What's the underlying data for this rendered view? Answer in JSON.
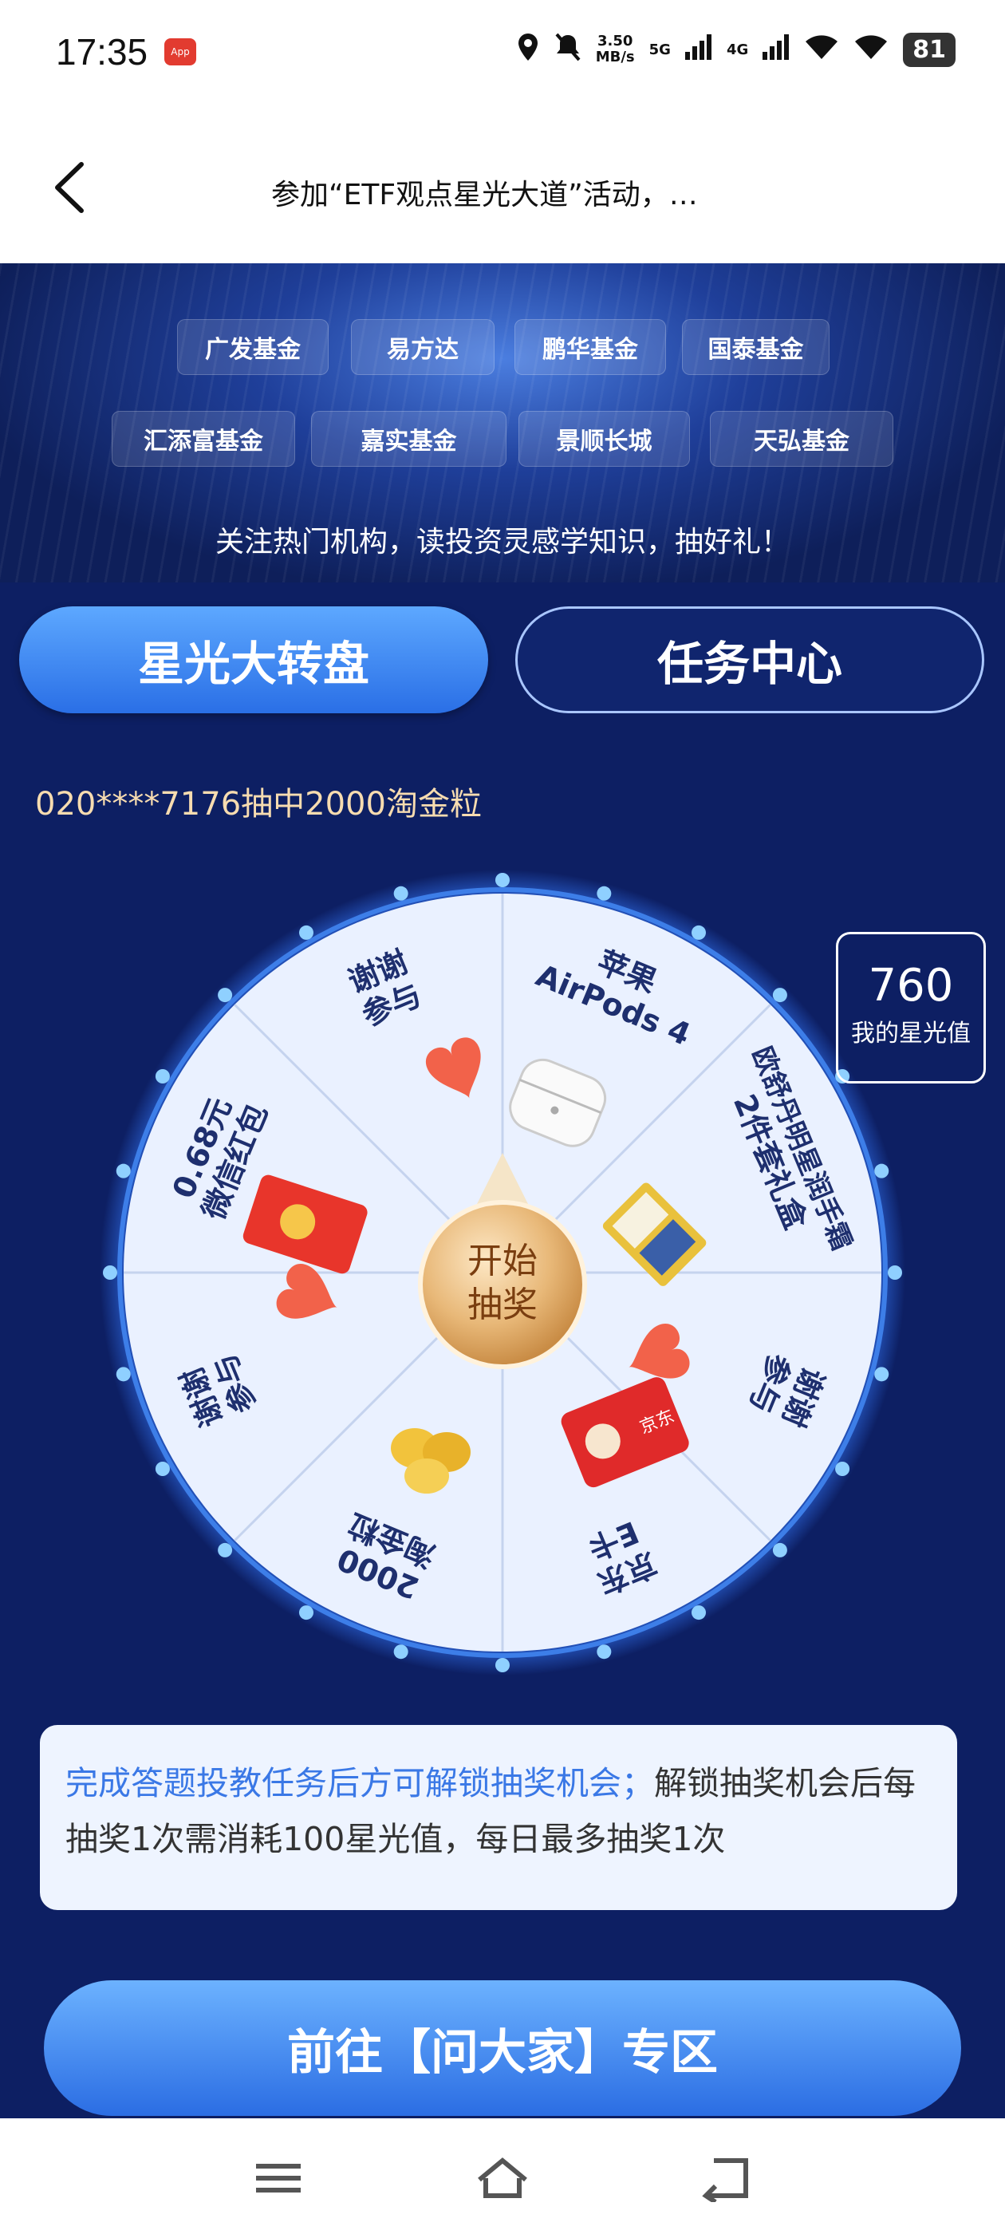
{
  "status": {
    "time": "17:35",
    "speed_value": "3.50",
    "speed_unit": "MB/s",
    "net1": "5G",
    "net2": "4G",
    "battery": "81"
  },
  "header": {
    "title": "参加“ETF观点星光大道”活动，…"
  },
  "banner": {
    "logos": [
      "广发基金",
      "易方达",
      "鹏华基金",
      "国泰基金",
      "汇添富基金",
      "嘉实基金",
      "景顺长城",
      "天弘基金"
    ],
    "slogan": "关注热门机构，读投资灵感学知识，抽好礼！"
  },
  "tabs": {
    "active": "星光大转盘",
    "inactive": "任务中心"
  },
  "ticker": "020****7176抽中2000淘金粒",
  "wheel": {
    "center_line1": "开始",
    "center_line2": "抽奖",
    "prizes": [
      {
        "line1": "苹果",
        "line2": "AirPods 4"
      },
      {
        "line1": "欧舒丹明星润手霜",
        "line2": "2件套礼盒"
      },
      {
        "line1": "谢谢",
        "line2": "参与"
      },
      {
        "line1": "京东",
        "line2": "E卡"
      },
      {
        "line1": "2000",
        "line2": "淘金粒"
      },
      {
        "line1": "谢谢",
        "line2": "参与"
      },
      {
        "line1": "0.68元",
        "line2": "微信红包"
      },
      {
        "line1": "谢谢",
        "line2": "参与"
      }
    ]
  },
  "stars": {
    "value": "760",
    "label": "我的星光值"
  },
  "note": {
    "highlight": "完成答题投教任务后方可解锁抽奖机会；",
    "rest": "解锁抽奖机会后每抽奖1次需消耗100星光值，每日最多抽奖1次"
  },
  "cta": "前往【问大家】专区"
}
